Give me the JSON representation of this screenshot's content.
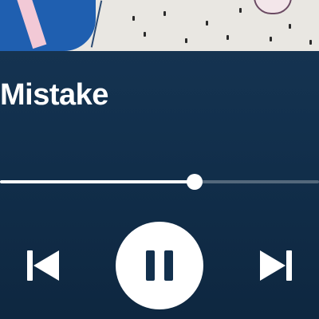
{
  "player": {
    "track_title": "Mistake",
    "artist": "",
    "progress_fraction": 0.61
  },
  "controls": {
    "previous": "skip-previous-icon",
    "play_pause": "pause-icon",
    "next": "skip-next-icon"
  },
  "colors": {
    "background": "#12304d",
    "accent": "#ffffff"
  }
}
